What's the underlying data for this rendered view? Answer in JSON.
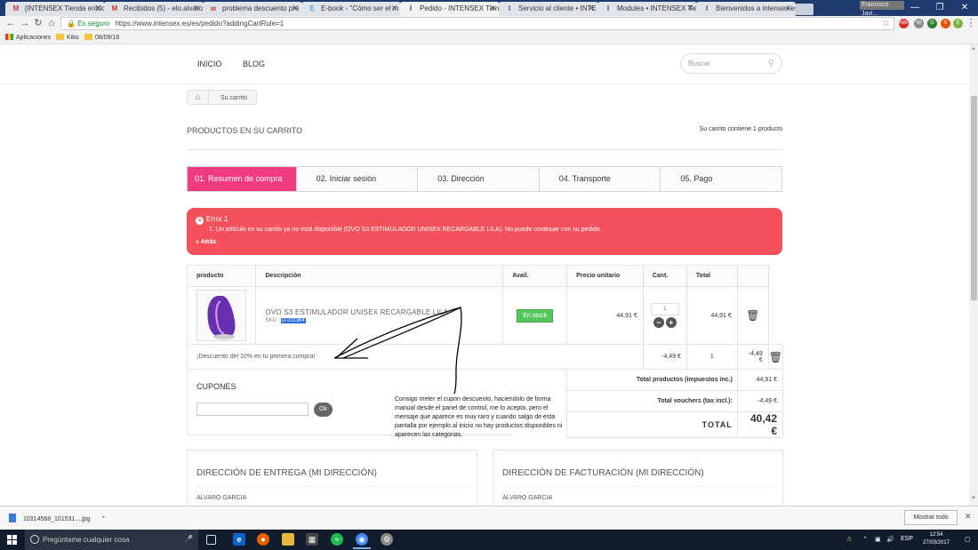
{
  "browser": {
    "tabs": [
      {
        "label": "[INTENSEX Tienda erótic",
        "favicon": "M",
        "fav_color": "#d93025"
      },
      {
        "label": "Recibidos (5) - elo.alvaro",
        "favicon": "M",
        "fav_color": "#d93025"
      },
      {
        "label": "problema descuento pre",
        "favicon": "w",
        "fav_color": "#d93025"
      },
      {
        "label": "E-book - \"Cómo ser el m",
        "favicon": "E",
        "fav_color": "#4aa3df"
      },
      {
        "label": "Pedido - INTENSEX Tienda",
        "favicon": "I",
        "fav_color": "#2b4b8c",
        "active": true
      },
      {
        "label": "Servicio al cliente • INTE",
        "favicon": "I",
        "fav_color": "#2b4b8c"
      },
      {
        "label": "Modules • INTENSEX Tie",
        "favicon": "I",
        "fav_color": "#2b4b8c"
      },
      {
        "label": "Bienvenidos a intensex.es",
        "favicon": "I",
        "fav_color": "#2b4b8c"
      }
    ],
    "user": "Francisco Javi...",
    "address": {
      "secure_label": "Es seguro",
      "url": "https://www.intensex.es/es/pedido?addingCartRule=1"
    },
    "bookmarks": [
      {
        "label": "Aplicaciones",
        "icon": "apps-icon"
      },
      {
        "label": "Kiko",
        "icon": "folder-icon"
      },
      {
        "label": "08/09/16",
        "icon": "folder-icon"
      }
    ]
  },
  "site": {
    "nav": {
      "inicio": "INICIO",
      "blog": "BLOG"
    },
    "search_placeholder": "Buscar",
    "breadcrumb_current": "Su carrito"
  },
  "cart": {
    "title": "PRODUCTOS EN SU CARRITO",
    "count_text": "Su carrito contiene 1 producto",
    "steps": [
      "01. Resumen de compra",
      "02. Iniciar sesión",
      "03. Dirección",
      "04. Transporte",
      "05. Pago"
    ],
    "active_step": 0,
    "alert": {
      "title": "Error 1",
      "message": "1. Un artículo en su carrito ya no está disponible (OVO S3 ESTIMULADOR UNISEX RECARGABLE LILA). No puede continuar con su pedido.",
      "back": "« Atrás"
    },
    "columns": [
      "producto",
      "Descripción",
      "Avail.",
      "Precio unitario",
      "Cant.",
      "Total"
    ],
    "item": {
      "name": "OVO S3 ESTIMULADOR UNISEX RECARGABLE LILA",
      "sku_label": "SKU : ",
      "sku": "D-211364",
      "availability": "En stock",
      "unit_price": "44,91 €",
      "quantity": "1",
      "total": "44,91 €"
    },
    "discount": {
      "label": "¡Descuento del 10% en tu primera compra!",
      "unit_price": "-4,49 €",
      "quantity": "1",
      "total": "-4,49 €"
    },
    "coupons": {
      "title": "CUPONES",
      "ok": "Ok"
    },
    "totals": {
      "products_label": "Total productos (impuestos inc.)",
      "products_value": "44,91 €",
      "vouchers_label": "Total vouchers (tax incl.):",
      "vouchers_value": "-4,49 €",
      "total_label": "TOTAL",
      "total_value": "40,42 €"
    },
    "addresses": {
      "delivery_title": "DIRECCIÓN DE ENTREGA (MI DIRECCIÓN)",
      "delivery_name": "ALVARO GARCIA",
      "billing_title": "DIRECCIÓN DE FACTURACIÓN (MI DIRECCIÓN)",
      "billing_name": "ALVARO GARCIA"
    }
  },
  "annotation": "Consigo meter el cupon descuento, haciendolo de forma manual desde el panel de control, me lo acepta, pero el mensaje que aparece es muy raro y cuando salgo de esta pantalla por ejemplo al inicio no hay productos disponibles ni aparecen las categorias.",
  "download": {
    "file": "10314568_101531....jpg",
    "show_all": "Mostrar todo"
  },
  "taskbar": {
    "search_placeholder": "Pregúntame cualquier cosa",
    "lang": "ESP",
    "time": "12:54",
    "date": "27/03/2017"
  },
  "colors": {
    "accent": "#f13b80",
    "alert": "#f3515c",
    "stock": "#55c65e"
  }
}
